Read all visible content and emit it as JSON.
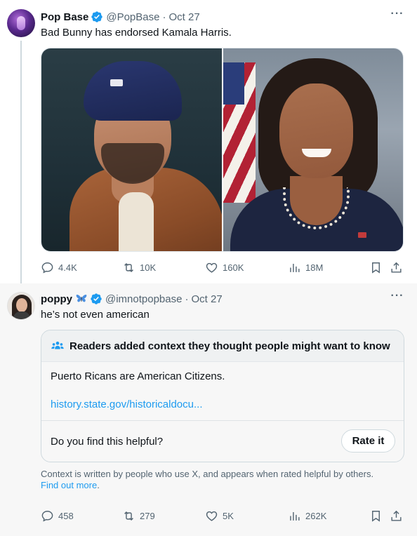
{
  "tweet1": {
    "name": "Pop Base",
    "handle": "@PopBase",
    "separator": "·",
    "date": "Oct 27",
    "text": "Bad Bunny has endorsed Kamala Harris.",
    "more_icon": "more-horizontal-icon",
    "actions": {
      "replies": "4.4K",
      "reposts": "10K",
      "likes": "160K",
      "views": "18M"
    }
  },
  "tweet2": {
    "name": "poppy",
    "name_emoji": "butterfly",
    "handle": "@imnotpopbase",
    "separator": "·",
    "date": "Oct 27",
    "text": "he’s not even american",
    "community_note": {
      "title": "Readers added context they thought people might want to know",
      "body": "Puerto Ricans are American Citizens.",
      "link": "history.state.gov/historicaldocu...",
      "question": "Do you find this helpful?",
      "rate_label": "Rate it"
    },
    "disclaimer": "Context is written by people who use X, and appears when rated helpful by others.",
    "disclaimer_link": "Find out more",
    "disclaimer_end": ".",
    "actions": {
      "replies": "458",
      "reposts": "279",
      "likes": "5K",
      "views": "262K"
    }
  },
  "colors": {
    "accent": "#1d9bf0",
    "muted_text": "#536471",
    "verified": "#1d9bf0"
  }
}
